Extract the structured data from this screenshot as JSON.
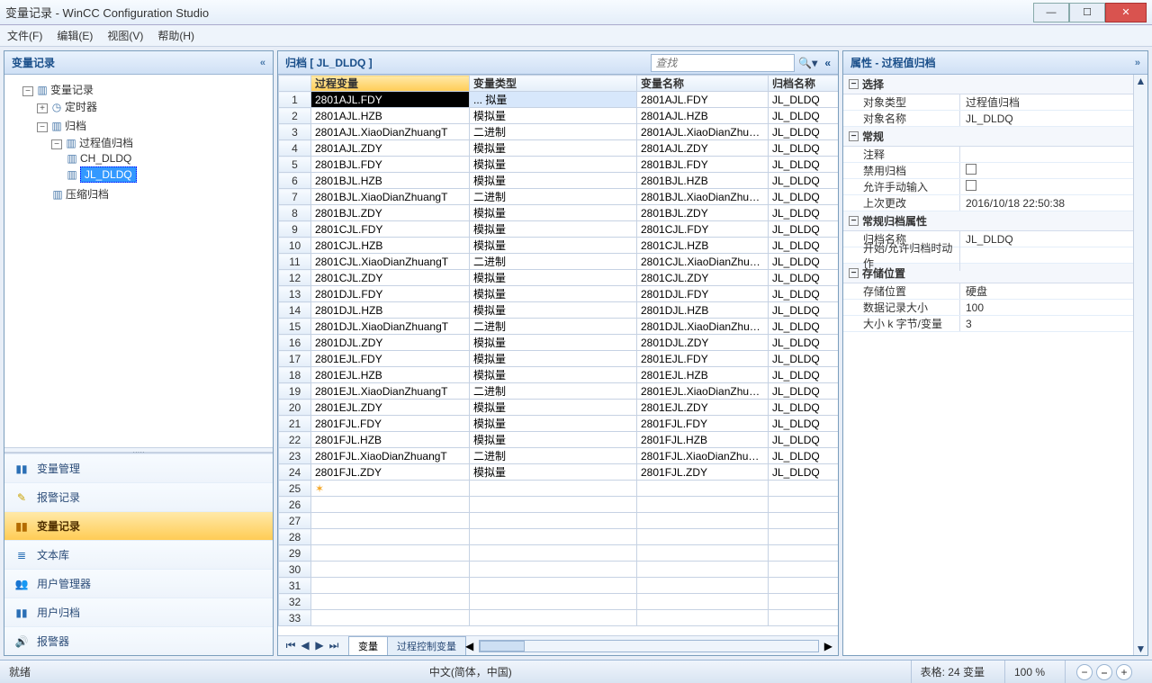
{
  "window": {
    "title": "变量记录 - WinCC Configuration Studio"
  },
  "menu": {
    "file": "文件(F)",
    "edit": "编辑(E)",
    "view": "视图(V)",
    "help": "帮助(H)"
  },
  "left": {
    "header": "变量记录",
    "tree": {
      "root": "变量记录",
      "timer": "定时器",
      "archive": "归档",
      "pvarchive": "过程值归档",
      "ch_dldq": "CH_DLDQ",
      "jl_dldq": "JL_DLDQ",
      "compressed": "压缩归档"
    },
    "nav": {
      "tag_mgmt": "变量管理",
      "alarm": "报警记录",
      "tag_log": "变量记录",
      "text_lib": "文本库",
      "user_admin": "用户管理器",
      "user_archive": "用户归档",
      "horn": "报警器"
    }
  },
  "mid": {
    "header": "归档  [  JL_DLDQ  ]",
    "search_placeholder": "查找",
    "columns": {
      "c1": "过程变量",
      "c2": "变量类型",
      "c3": "变量名称",
      "c4": "归档名称"
    },
    "rows": [
      {
        "n": 1,
        "pv": "2801AJL.FDY",
        "type": "... 拟量",
        "name": "2801AJL.FDY",
        "arc": "JL_DLDQ"
      },
      {
        "n": 2,
        "pv": "2801AJL.HZB",
        "type": "模拟量",
        "name": "2801AJL.HZB",
        "arc": "JL_DLDQ"
      },
      {
        "n": 3,
        "pv": "2801AJL.XiaoDianZhuangT",
        "type": "二进制",
        "name": "2801AJL.XiaoDianZhuangT",
        "arc": "JL_DLDQ"
      },
      {
        "n": 4,
        "pv": "2801AJL.ZDY",
        "type": "模拟量",
        "name": "2801AJL.ZDY",
        "arc": "JL_DLDQ"
      },
      {
        "n": 5,
        "pv": "2801BJL.FDY",
        "type": "模拟量",
        "name": "2801BJL.FDY",
        "arc": "JL_DLDQ"
      },
      {
        "n": 6,
        "pv": "2801BJL.HZB",
        "type": "模拟量",
        "name": "2801BJL.HZB",
        "arc": "JL_DLDQ"
      },
      {
        "n": 7,
        "pv": "2801BJL.XiaoDianZhuangT",
        "type": "二进制",
        "name": "2801BJL.XiaoDianZhuangT",
        "arc": "JL_DLDQ"
      },
      {
        "n": 8,
        "pv": "2801BJL.ZDY",
        "type": "模拟量",
        "name": "2801BJL.ZDY",
        "arc": "JL_DLDQ"
      },
      {
        "n": 9,
        "pv": "2801CJL.FDY",
        "type": "模拟量",
        "name": "2801CJL.FDY",
        "arc": "JL_DLDQ"
      },
      {
        "n": 10,
        "pv": "2801CJL.HZB",
        "type": "模拟量",
        "name": "2801CJL.HZB",
        "arc": "JL_DLDQ"
      },
      {
        "n": 11,
        "pv": "2801CJL.XiaoDianZhuangT",
        "type": "二进制",
        "name": "2801CJL.XiaoDianZhuangT",
        "arc": "JL_DLDQ"
      },
      {
        "n": 12,
        "pv": "2801CJL.ZDY",
        "type": "模拟量",
        "name": "2801CJL.ZDY",
        "arc": "JL_DLDQ"
      },
      {
        "n": 13,
        "pv": "2801DJL.FDY",
        "type": "模拟量",
        "name": "2801DJL.FDY",
        "arc": "JL_DLDQ"
      },
      {
        "n": 14,
        "pv": "2801DJL.HZB",
        "type": "模拟量",
        "name": "2801DJL.HZB",
        "arc": "JL_DLDQ"
      },
      {
        "n": 15,
        "pv": "2801DJL.XiaoDianZhuangT",
        "type": "二进制",
        "name": "2801DJL.XiaoDianZhuangT",
        "arc": "JL_DLDQ"
      },
      {
        "n": 16,
        "pv": "2801DJL.ZDY",
        "type": "模拟量",
        "name": "2801DJL.ZDY",
        "arc": "JL_DLDQ"
      },
      {
        "n": 17,
        "pv": "2801EJL.FDY",
        "type": "模拟量",
        "name": "2801EJL.FDY",
        "arc": "JL_DLDQ"
      },
      {
        "n": 18,
        "pv": "2801EJL.HZB",
        "type": "模拟量",
        "name": "2801EJL.HZB",
        "arc": "JL_DLDQ"
      },
      {
        "n": 19,
        "pv": "2801EJL.XiaoDianZhuangT",
        "type": "二进制",
        "name": "2801EJL.XiaoDianZhuangT",
        "arc": "JL_DLDQ"
      },
      {
        "n": 20,
        "pv": "2801EJL.ZDY",
        "type": "模拟量",
        "name": "2801EJL.ZDY",
        "arc": "JL_DLDQ"
      },
      {
        "n": 21,
        "pv": "2801FJL.FDY",
        "type": "模拟量",
        "name": "2801FJL.FDY",
        "arc": "JL_DLDQ"
      },
      {
        "n": 22,
        "pv": "2801FJL.HZB",
        "type": "模拟量",
        "name": "2801FJL.HZB",
        "arc": "JL_DLDQ"
      },
      {
        "n": 23,
        "pv": "2801FJL.XiaoDianZhuangT",
        "type": "二进制",
        "name": "2801FJL.XiaoDianZhuangT",
        "arc": "JL_DLDQ"
      },
      {
        "n": 24,
        "pv": "2801FJL.ZDY",
        "type": "模拟量",
        "name": "2801FJL.ZDY",
        "arc": "JL_DLDQ"
      }
    ],
    "empty_rows": [
      25,
      26,
      27,
      28,
      29,
      30,
      31,
      32,
      33
    ],
    "star_row_index": 25,
    "tabs": {
      "t1": "变量",
      "t2": "过程控制变量"
    }
  },
  "right": {
    "header": "属性  -  过程值归档",
    "groups": {
      "select": {
        "title": "选择",
        "obj_type_k": "对象类型",
        "obj_type_v": "过程值归档",
        "obj_name_k": "对象名称",
        "obj_name_v": "JL_DLDQ"
      },
      "general": {
        "title": "常规",
        "comment_k": "注释",
        "comment_v": "",
        "disable_k": "禁用归档",
        "manual_k": "允许手动输入",
        "last_mod_k": "上次更改",
        "last_mod_v": "2016/10/18 22:50:38"
      },
      "arc_attr": {
        "title": "常规归档属性",
        "arc_name_k": "归档名称",
        "arc_name_v": "JL_DLDQ",
        "start_k": "开始/允许归档时动作"
      },
      "storage": {
        "title": "存储位置",
        "loc_k": "存储位置",
        "loc_v": "硬盘",
        "rec_size_k": "数据记录大小",
        "rec_size_v": "100",
        "kb_k": "大小 k 字节/变量",
        "kb_v": "3"
      }
    }
  },
  "status": {
    "ready": "就绪",
    "lang": "中文(简体，中国)",
    "table": "表格: 24 变量",
    "zoom": "100 %"
  }
}
